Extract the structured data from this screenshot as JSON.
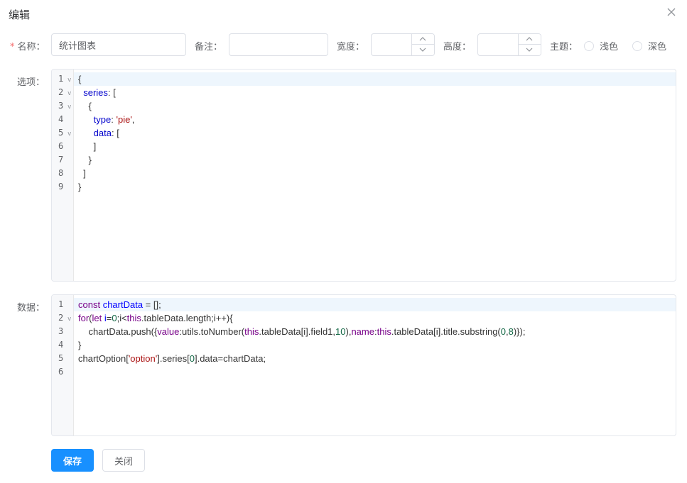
{
  "dialog": {
    "title": "编辑"
  },
  "form": {
    "name_label": "名称：",
    "name_value": "统计图表",
    "remark_label": "备注：",
    "remark_value": "",
    "width_label": "宽度：",
    "width_value": "",
    "height_label": "高度：",
    "height_value": "",
    "theme_label": "主题：",
    "theme_light": "浅色",
    "theme_dark": "深色",
    "options_label": "选项：",
    "data_label": "数据："
  },
  "options_editor": {
    "lines": [
      {
        "num": "1",
        "fold": "v",
        "code": [
          {
            "t": "{",
            "c": ""
          }
        ]
      },
      {
        "num": "2",
        "fold": "v",
        "code": [
          {
            "t": "  ",
            "c": ""
          },
          {
            "t": "series",
            "c": "prop"
          },
          {
            "t": ": [",
            "c": ""
          }
        ]
      },
      {
        "num": "3",
        "fold": "v",
        "code": [
          {
            "t": "    {",
            "c": ""
          }
        ]
      },
      {
        "num": "4",
        "fold": "",
        "code": [
          {
            "t": "      ",
            "c": ""
          },
          {
            "t": "type",
            "c": "prop"
          },
          {
            "t": ": ",
            "c": ""
          },
          {
            "t": "'pie'",
            "c": "str"
          },
          {
            "t": ",",
            "c": ""
          }
        ]
      },
      {
        "num": "5",
        "fold": "v",
        "code": [
          {
            "t": "      ",
            "c": ""
          },
          {
            "t": "data",
            "c": "prop"
          },
          {
            "t": ": [",
            "c": ""
          }
        ]
      },
      {
        "num": "6",
        "fold": "",
        "code": [
          {
            "t": "      ]",
            "c": ""
          }
        ]
      },
      {
        "num": "7",
        "fold": "",
        "code": [
          {
            "t": "    }",
            "c": ""
          }
        ]
      },
      {
        "num": "8",
        "fold": "",
        "code": [
          {
            "t": "  ]",
            "c": ""
          }
        ]
      },
      {
        "num": "9",
        "fold": "",
        "code": [
          {
            "t": "}",
            "c": ""
          }
        ]
      }
    ]
  },
  "data_editor": {
    "lines": [
      {
        "num": "1",
        "fold": "",
        "code": [
          {
            "t": "const ",
            "c": "kw"
          },
          {
            "t": "chartData",
            "c": "def"
          },
          {
            "t": " = [];",
            "c": ""
          }
        ]
      },
      {
        "num": "2",
        "fold": "v",
        "code": [
          {
            "t": "for",
            "c": "kw"
          },
          {
            "t": "(",
            "c": ""
          },
          {
            "t": "let ",
            "c": "kw"
          },
          {
            "t": "i",
            "c": "def"
          },
          {
            "t": "=",
            "c": ""
          },
          {
            "t": "0",
            "c": "numc"
          },
          {
            "t": ";i<",
            "c": ""
          },
          {
            "t": "this",
            "c": "kw"
          },
          {
            "t": ".tableData.length;i++){",
            "c": ""
          }
        ]
      },
      {
        "num": "3",
        "fold": "",
        "code": [
          {
            "t": "    chartData.push({",
            "c": ""
          },
          {
            "t": "value",
            "c": "kw"
          },
          {
            "t": ":utils.toNumber(",
            "c": ""
          },
          {
            "t": "this",
            "c": "kw"
          },
          {
            "t": ".tableData[i].field1,",
            "c": ""
          },
          {
            "t": "10",
            "c": "numc"
          },
          {
            "t": "),",
            "c": ""
          },
          {
            "t": "name",
            "c": "kw"
          },
          {
            "t": ":",
            "c": ""
          },
          {
            "t": "this",
            "c": "kw"
          },
          {
            "t": ".tableData[i].title.substring(",
            "c": ""
          },
          {
            "t": "0",
            "c": "numc"
          },
          {
            "t": ",",
            "c": ""
          },
          {
            "t": "8",
            "c": "numc"
          },
          {
            "t": ")});",
            "c": ""
          }
        ]
      },
      {
        "num": "4",
        "fold": "",
        "code": [
          {
            "t": "}",
            "c": ""
          }
        ]
      },
      {
        "num": "5",
        "fold": "",
        "code": [
          {
            "t": "chartOption[",
            "c": ""
          },
          {
            "t": "'option'",
            "c": "str"
          },
          {
            "t": "].series[",
            "c": ""
          },
          {
            "t": "0",
            "c": "numc"
          },
          {
            "t": "].data=chartData;",
            "c": ""
          }
        ]
      },
      {
        "num": "6",
        "fold": "",
        "code": [
          {
            "t": "",
            "c": ""
          }
        ]
      }
    ]
  },
  "buttons": {
    "save": "保存",
    "close": "关闭"
  }
}
